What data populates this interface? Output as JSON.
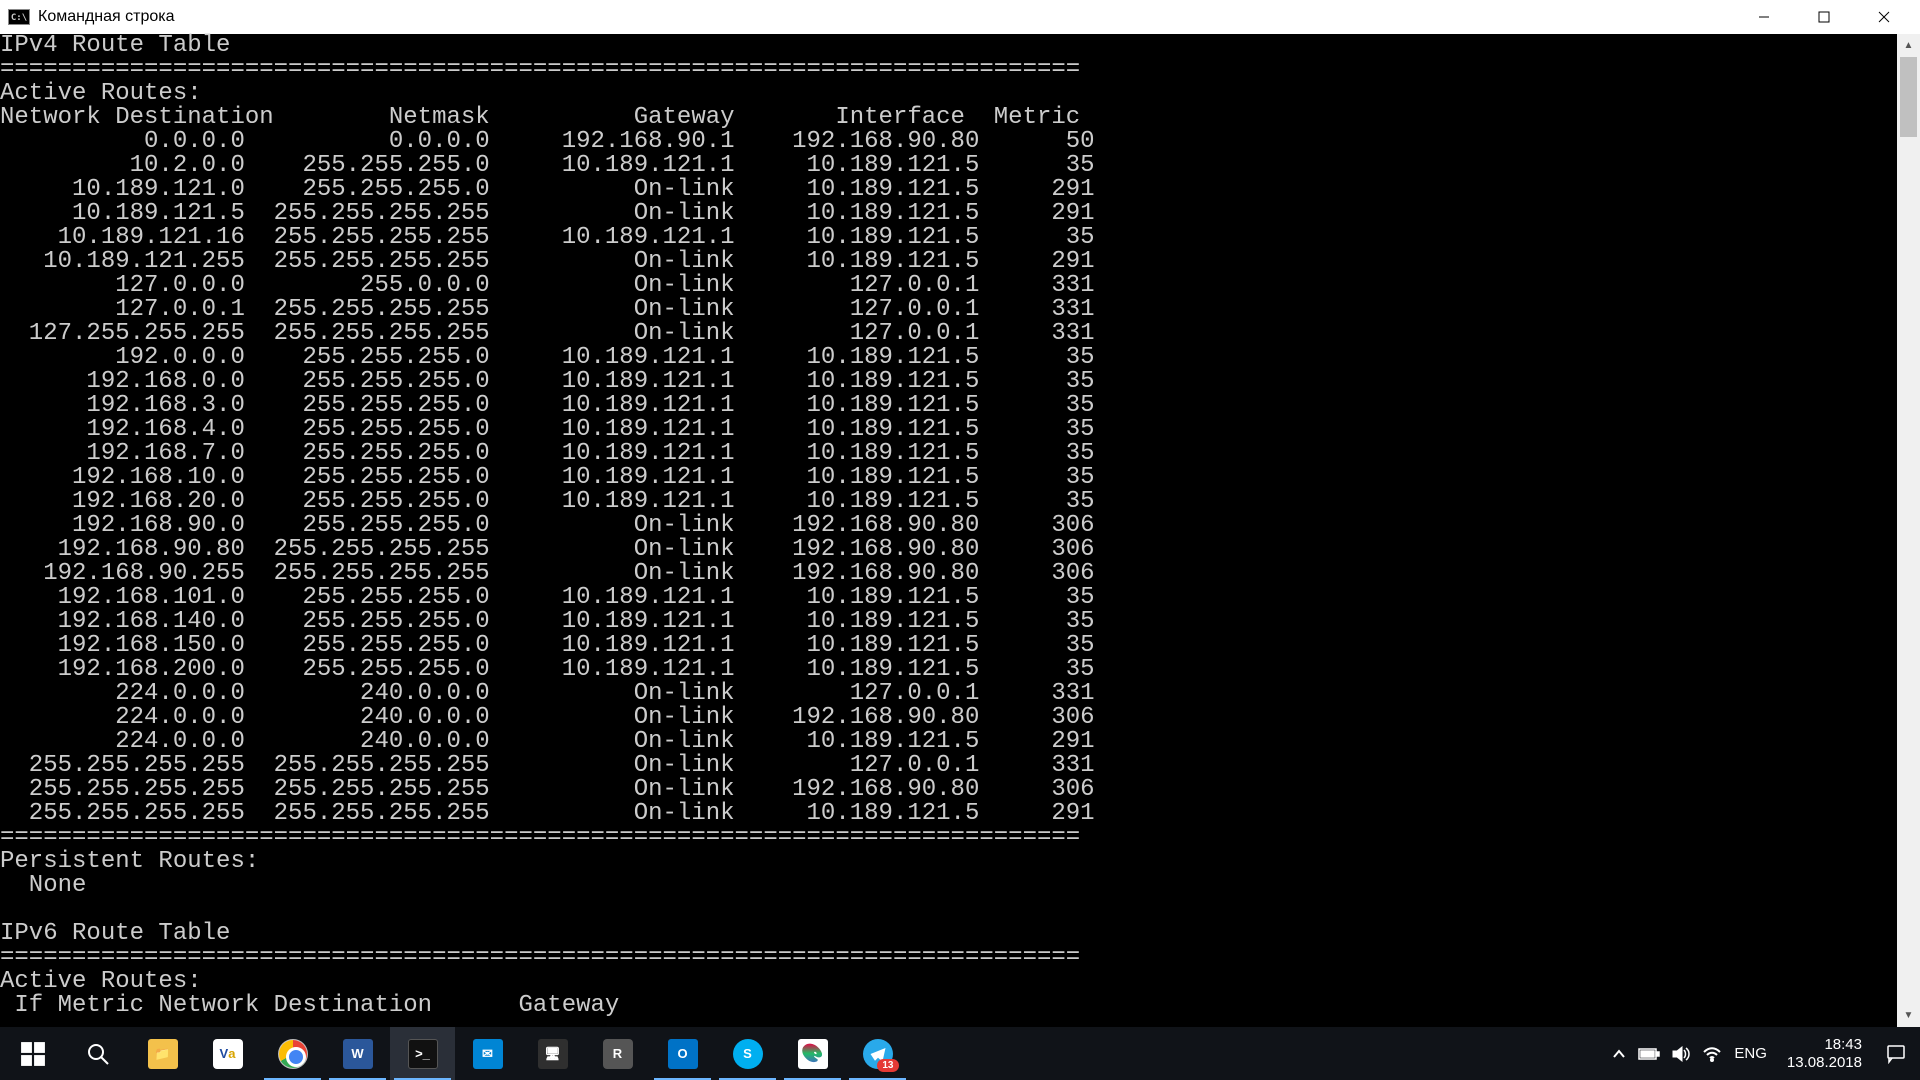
{
  "window": {
    "app_icon_text": "C:\\",
    "title": "Командная строка"
  },
  "terminal": {
    "lines": [
      "IPv4 Route Table",
      "===========================================================================",
      "Active Routes:",
      "header",
      "sep",
      "Persistent Routes:",
      "  None",
      "",
      "IPv6 Route Table",
      "===========================================================================",
      "Active Routes:",
      " If Metric Network Destination      Gateway"
    ],
    "header": {
      "c1": "Network Destination",
      "c2": "Netmask",
      "c3": "Gateway",
      "c4": "Interface",
      "c5": "Metric"
    },
    "routes": [
      {
        "c1": "0.0.0.0",
        "c2": "0.0.0.0",
        "c3": "192.168.90.1",
        "c4": "192.168.90.80",
        "c5": "50"
      },
      {
        "c1": "10.2.0.0",
        "c2": "255.255.255.0",
        "c3": "10.189.121.1",
        "c4": "10.189.121.5",
        "c5": "35"
      },
      {
        "c1": "10.189.121.0",
        "c2": "255.255.255.0",
        "c3": "On-link",
        "c4": "10.189.121.5",
        "c5": "291"
      },
      {
        "c1": "10.189.121.5",
        "c2": "255.255.255.255",
        "c3": "On-link",
        "c4": "10.189.121.5",
        "c5": "291"
      },
      {
        "c1": "10.189.121.16",
        "c2": "255.255.255.255",
        "c3": "10.189.121.1",
        "c4": "10.189.121.5",
        "c5": "35"
      },
      {
        "c1": "10.189.121.255",
        "c2": "255.255.255.255",
        "c3": "On-link",
        "c4": "10.189.121.5",
        "c5": "291"
      },
      {
        "c1": "127.0.0.0",
        "c2": "255.0.0.0",
        "c3": "On-link",
        "c4": "127.0.0.1",
        "c5": "331"
      },
      {
        "c1": "127.0.0.1",
        "c2": "255.255.255.255",
        "c3": "On-link",
        "c4": "127.0.0.1",
        "c5": "331"
      },
      {
        "c1": "127.255.255.255",
        "c2": "255.255.255.255",
        "c3": "On-link",
        "c4": "127.0.0.1",
        "c5": "331"
      },
      {
        "c1": "192.0.0.0",
        "c2": "255.255.255.0",
        "c3": "10.189.121.1",
        "c4": "10.189.121.5",
        "c5": "35"
      },
      {
        "c1": "192.168.0.0",
        "c2": "255.255.255.0",
        "c3": "10.189.121.1",
        "c4": "10.189.121.5",
        "c5": "35"
      },
      {
        "c1": "192.168.3.0",
        "c2": "255.255.255.0",
        "c3": "10.189.121.1",
        "c4": "10.189.121.5",
        "c5": "35"
      },
      {
        "c1": "192.168.4.0",
        "c2": "255.255.255.0",
        "c3": "10.189.121.1",
        "c4": "10.189.121.5",
        "c5": "35"
      },
      {
        "c1": "192.168.7.0",
        "c2": "255.255.255.0",
        "c3": "10.189.121.1",
        "c4": "10.189.121.5",
        "c5": "35"
      },
      {
        "c1": "192.168.10.0",
        "c2": "255.255.255.0",
        "c3": "10.189.121.1",
        "c4": "10.189.121.5",
        "c5": "35"
      },
      {
        "c1": "192.168.20.0",
        "c2": "255.255.255.0",
        "c3": "10.189.121.1",
        "c4": "10.189.121.5",
        "c5": "35"
      },
      {
        "c1": "192.168.90.0",
        "c2": "255.255.255.0",
        "c3": "On-link",
        "c4": "192.168.90.80",
        "c5": "306"
      },
      {
        "c1": "192.168.90.80",
        "c2": "255.255.255.255",
        "c3": "On-link",
        "c4": "192.168.90.80",
        "c5": "306"
      },
      {
        "c1": "192.168.90.255",
        "c2": "255.255.255.255",
        "c3": "On-link",
        "c4": "192.168.90.80",
        "c5": "306"
      },
      {
        "c1": "192.168.101.0",
        "c2": "255.255.255.0",
        "c3": "10.189.121.1",
        "c4": "10.189.121.5",
        "c5": "35"
      },
      {
        "c1": "192.168.140.0",
        "c2": "255.255.255.0",
        "c3": "10.189.121.1",
        "c4": "10.189.121.5",
        "c5": "35"
      },
      {
        "c1": "192.168.150.0",
        "c2": "255.255.255.0",
        "c3": "10.189.121.1",
        "c4": "10.189.121.5",
        "c5": "35"
      },
      {
        "c1": "192.168.200.0",
        "c2": "255.255.255.0",
        "c3": "10.189.121.1",
        "c4": "10.189.121.5",
        "c5": "35"
      },
      {
        "c1": "224.0.0.0",
        "c2": "240.0.0.0",
        "c3": "On-link",
        "c4": "127.0.0.1",
        "c5": "331"
      },
      {
        "c1": "224.0.0.0",
        "c2": "240.0.0.0",
        "c3": "On-link",
        "c4": "192.168.90.80",
        "c5": "306"
      },
      {
        "c1": "224.0.0.0",
        "c2": "240.0.0.0",
        "c3": "On-link",
        "c4": "10.189.121.5",
        "c5": "291"
      },
      {
        "c1": "255.255.255.255",
        "c2": "255.255.255.255",
        "c3": "On-link",
        "c4": "127.0.0.1",
        "c5": "331"
      },
      {
        "c1": "255.255.255.255",
        "c2": "255.255.255.255",
        "c3": "On-link",
        "c4": "192.168.90.80",
        "c5": "306"
      },
      {
        "c1": "255.255.255.255",
        "c2": "255.255.255.255",
        "c3": "On-link",
        "c4": "10.189.121.5",
        "c5": "291"
      }
    ]
  },
  "taskbar": {
    "telegram_badge": "13",
    "lang": "ENG",
    "time": "18:43",
    "date": "13.08.2018"
  }
}
